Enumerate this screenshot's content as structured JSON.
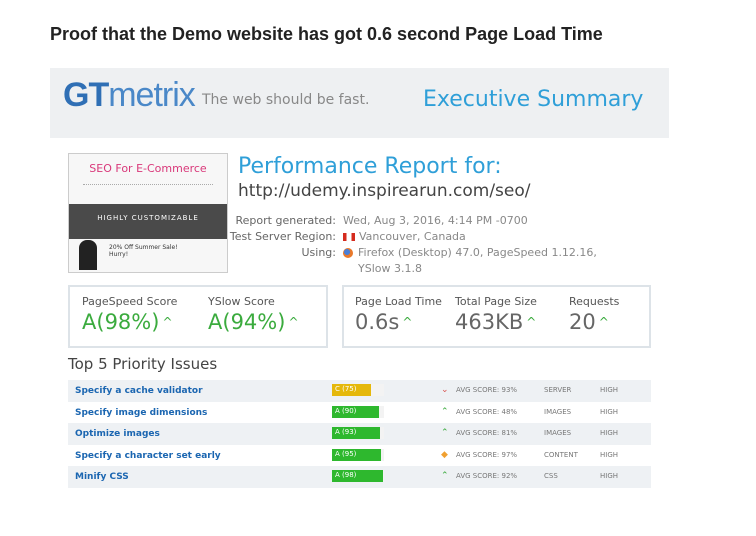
{
  "heading": "Proof that the Demo website has got 0.6 second Page Load Time",
  "header": {
    "logo_gt": "GT",
    "logo_metrix": "metrix",
    "tagline": "The web should be fast.",
    "section": "Executive Summary"
  },
  "thumbnail": {
    "title": "SEO For E-Commerce",
    "hero": "HIGHLY CUSTOMIZABLE",
    "promo": "20% Off Summer Sale! Hurry!"
  },
  "report": {
    "title": "Performance Report for:",
    "url": "http://udemy.inspirearun.com/seo/",
    "meta": [
      {
        "label": "Report generated:",
        "value": "Wed, Aug 3, 2016, 4:14 PM -0700"
      },
      {
        "label": "Test Server Region:",
        "value": "Vancouver, Canada"
      },
      {
        "label": "Using:",
        "value": "Firefox (Desktop) 47.0, PageSpeed 1.12.16,"
      },
      {
        "label": "",
        "value": "YSlow 3.1.8"
      }
    ]
  },
  "scores": {
    "pagespeed": {
      "label": "PageSpeed Score",
      "grade": "A",
      "value": "(98%)"
    },
    "yslow": {
      "label": "YSlow Score",
      "grade": "A",
      "value": "(94%)"
    }
  },
  "timings": {
    "load": {
      "label": "Page Load Time",
      "value": "0.6s"
    },
    "size": {
      "label": "Total Page Size",
      "value": "463KB"
    },
    "requests": {
      "label": "Requests",
      "value": "20"
    }
  },
  "issues_title": "Top 5 Priority Issues",
  "issues": [
    {
      "name": "Specify a cache validator",
      "grade": "C (75)",
      "score": 75,
      "color": "#e5b80b",
      "icon": "down-arrow-icon",
      "icon_color": "#d9534f",
      "avg": "AVG SCORE: 93%",
      "type": "SERVER",
      "priority": "HIGH"
    },
    {
      "name": "Specify image dimensions",
      "grade": "A (90)",
      "score": 90,
      "color": "#2eb82e",
      "icon": "up-arrow-icon",
      "icon_color": "#3bab3e",
      "avg": "AVG SCORE: 48%",
      "type": "IMAGES",
      "priority": "HIGH"
    },
    {
      "name": "Optimize images",
      "grade": "A (93)",
      "score": 93,
      "color": "#2eb82e",
      "icon": "up-arrow-icon",
      "icon_color": "#3bab3e",
      "avg": "AVG SCORE: 81%",
      "type": "IMAGES",
      "priority": "HIGH"
    },
    {
      "name": "Specify a character set early",
      "grade": "A (95)",
      "score": 95,
      "color": "#2eb82e",
      "icon": "diamond-icon",
      "icon_color": "#f0a030",
      "avg": "AVG SCORE: 97%",
      "type": "CONTENT",
      "priority": "HIGH"
    },
    {
      "name": "Minify CSS",
      "grade": "A (98)",
      "score": 98,
      "color": "#2eb82e",
      "icon": "up-arrow-icon",
      "icon_color": "#3bab3e",
      "avg": "AVG SCORE: 92%",
      "type": "CSS",
      "priority": "HIGH"
    }
  ]
}
